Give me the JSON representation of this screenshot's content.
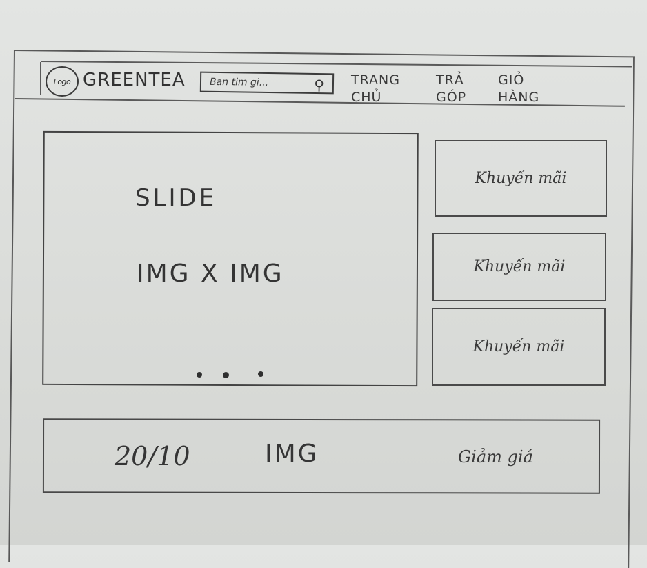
{
  "header": {
    "logo_text": "Logo",
    "brand_name": "GREENTEA",
    "search": {
      "placeholder": "Ban tim gi...",
      "icon": "search-icon"
    },
    "nav": [
      {
        "line1": "TRANG",
        "line2": "CHỦ"
      },
      {
        "line1": "TRẢ",
        "line2": "GÓP"
      },
      {
        "line1": "GIỎ",
        "line2": "HÀNG"
      }
    ]
  },
  "slider": {
    "title": "SLIDE",
    "image_text": "IMG X IMG",
    "dots": 3
  },
  "promotions": [
    {
      "label": "Khuyến mãi"
    },
    {
      "label": "Khuyến mãi"
    },
    {
      "label": "Khuyến mãi"
    }
  ],
  "banner": {
    "date": "20/10",
    "image_text": "IMG",
    "discount": "Giảm giá"
  }
}
